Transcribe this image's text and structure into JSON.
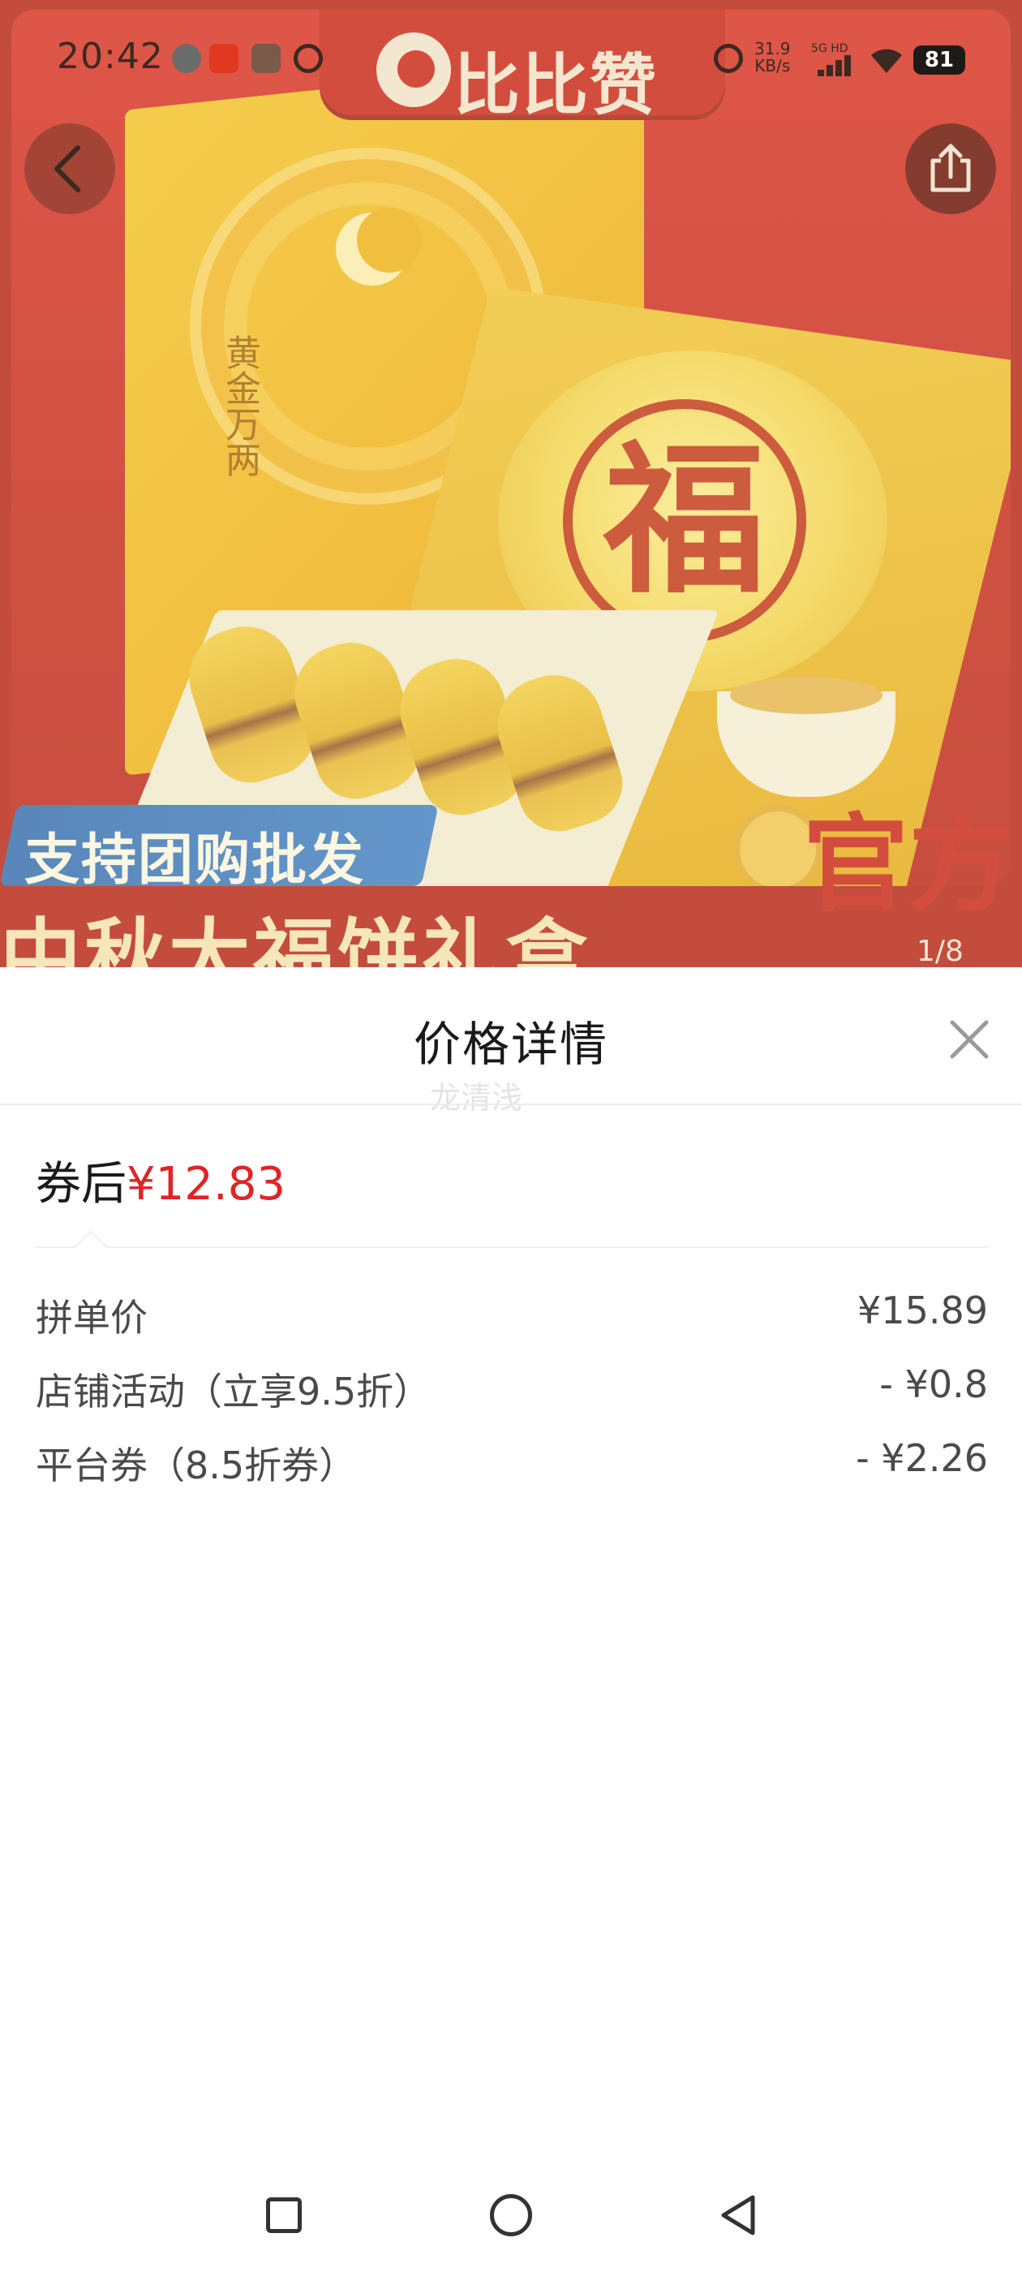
{
  "status_bar": {
    "time": "20:42",
    "net_speed_value": "31.9",
    "net_speed_unit": "KB/s",
    "network_type": "5G HD",
    "battery": "81"
  },
  "hero": {
    "brand": "比比赞",
    "box_text": "黄金万两",
    "cake_char": "福",
    "promo_banner": "支持团购批发",
    "official_text": "官方",
    "bottom_title": "中秋大福饼礼盒",
    "page_indicator": "1/8"
  },
  "sheet": {
    "title": "价格详情",
    "watermark": "龙清浅",
    "after_coupon_label": "券后",
    "after_coupon_price": "¥12.83",
    "rows": [
      {
        "label": "拼单价",
        "value": "¥15.89"
      },
      {
        "label": "店铺活动（立享9.5折）",
        "value": "- ¥0.8"
      },
      {
        "label": "平台券（8.5折券）",
        "value": "- ¥2.26"
      }
    ]
  },
  "colors": {
    "accent_red": "#e02424",
    "hero_red": "#c8141d"
  },
  "icons": {
    "back": "chevron-left-icon",
    "share": "share-icon",
    "close": "close-icon",
    "nav_recent": "square-icon",
    "nav_home": "circle-icon",
    "nav_back": "triangle-back-icon"
  }
}
